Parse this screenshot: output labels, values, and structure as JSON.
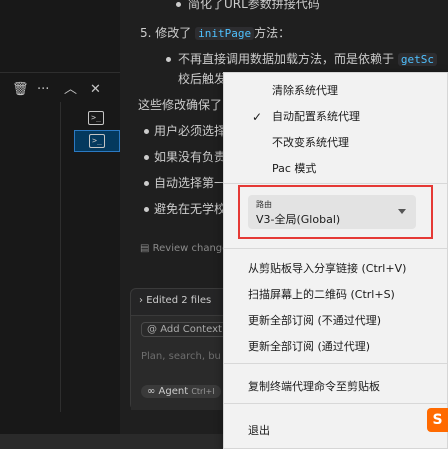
{
  "terminal": {
    "toolbar_icons": [
      "trash-icon",
      "more-icon",
      "chevron-up-icon",
      "close-icon"
    ],
    "items": [
      {
        "icon": "terminal-icon",
        "selected": false
      },
      {
        "icon": "terminal-icon",
        "selected": true
      }
    ]
  },
  "chat": {
    "top_bullet": "简化了URL参数拼接代码",
    "step5_prefix": "5. 修改了",
    "step5_code": "initPage",
    "step5_suffix": "方法：",
    "sub_bullet_line1": "不再直接调用数据加载方法，而是依赖于",
    "sub_bullet_code": "getSc",
    "sub_bullet_line2": "校后触发",
    "summary": "这些修改确保了",
    "bullets": [
      "用户必须选择",
      "如果没有负责",
      "自动选择第一",
      "避免在无学校"
    ],
    "right_fragment": "果",
    "review_changes": "Review change",
    "edited_files": "Edited 2 files",
    "add_context": "Add Context",
    "placeholder": "Plan, search, bu",
    "agent_label": "Agent",
    "agent_shortcut": "Ctrl+I"
  },
  "menu": {
    "proxy_items": [
      {
        "label": "清除系统代理",
        "checked": false
      },
      {
        "label": "自动配置系统代理",
        "checked": true
      },
      {
        "label": "不改变系统代理",
        "checked": false
      },
      {
        "label": "Pac 模式",
        "checked": false
      }
    ],
    "route": {
      "label": "路由",
      "value": "V3-全局(Global)"
    },
    "actions": [
      "从剪贴板导入分享链接 (Ctrl+V)",
      "扫描屏幕上的二维码 (Ctrl+S)",
      "更新全部订阅 (不通过代理)",
      "更新全部订阅 (通过代理)"
    ],
    "copy_cmd": "复制终端代理命令至剪贴板",
    "exit": "退出",
    "highlight_color": "#e53935"
  },
  "tray": {
    "ime_badge": "S"
  }
}
